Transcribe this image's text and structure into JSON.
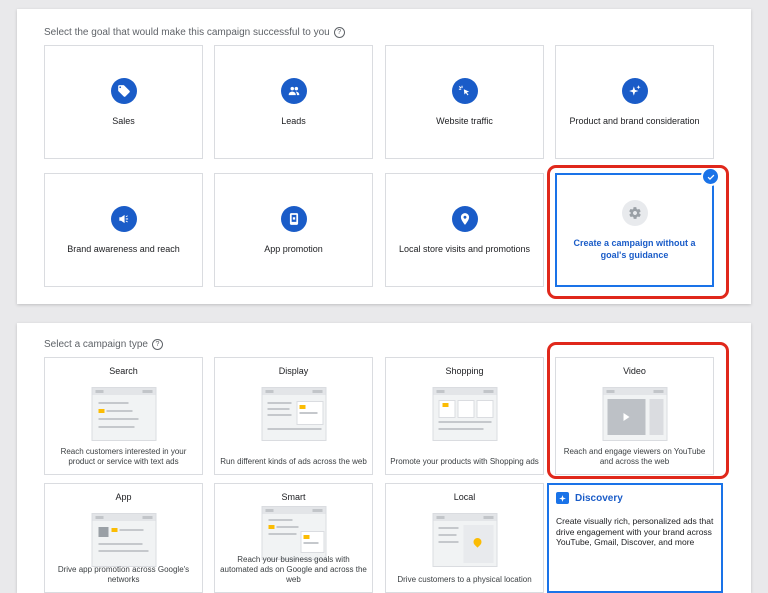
{
  "goal_section": {
    "heading": "Select the goal that would make this campaign successful to you",
    "help_icon": "?",
    "goals": [
      {
        "label": "Sales",
        "icon": "tag-icon"
      },
      {
        "label": "Leads",
        "icon": "people-icon"
      },
      {
        "label": "Website traffic",
        "icon": "cursor-click-icon"
      },
      {
        "label": "Product and brand consideration",
        "icon": "sparkle-icon"
      },
      {
        "label": "Brand awareness and reach",
        "icon": "megaphone-icon"
      },
      {
        "label": "App promotion",
        "icon": "phone-icon"
      },
      {
        "label": "Local store visits and promotions",
        "icon": "location-pin-icon"
      },
      {
        "label": "Create a campaign without a goal's guidance",
        "icon": "gear-icon",
        "selected": true
      }
    ]
  },
  "type_section": {
    "heading": "Select a campaign type",
    "help_icon": "?",
    "types": [
      {
        "title": "Search",
        "description": "Reach customers interested in your product or service with text ads"
      },
      {
        "title": "Display",
        "description": "Run different kinds of ads across the web"
      },
      {
        "title": "Shopping",
        "description": "Promote your products with Shopping ads"
      },
      {
        "title": "Video",
        "description": "Reach and engage viewers on YouTube and across the web"
      },
      {
        "title": "App",
        "description": "Drive app promotion across Google's networks"
      },
      {
        "title": "Smart",
        "description": "Reach your business goals with automated ads on Google and across the web"
      },
      {
        "title": "Local",
        "description": "Drive customers to a physical location"
      },
      {
        "title": "Discovery",
        "description": "Create visually rich, personalized ads that drive engagement with your brand across YouTube, Gmail, Discover, and more",
        "selected": true
      }
    ]
  },
  "colors": {
    "brand_blue": "#1a5cc8",
    "selection_blue": "#1a73e8",
    "highlight_red": "#e0281b",
    "accent_yellow": "#fbbc04"
  }
}
